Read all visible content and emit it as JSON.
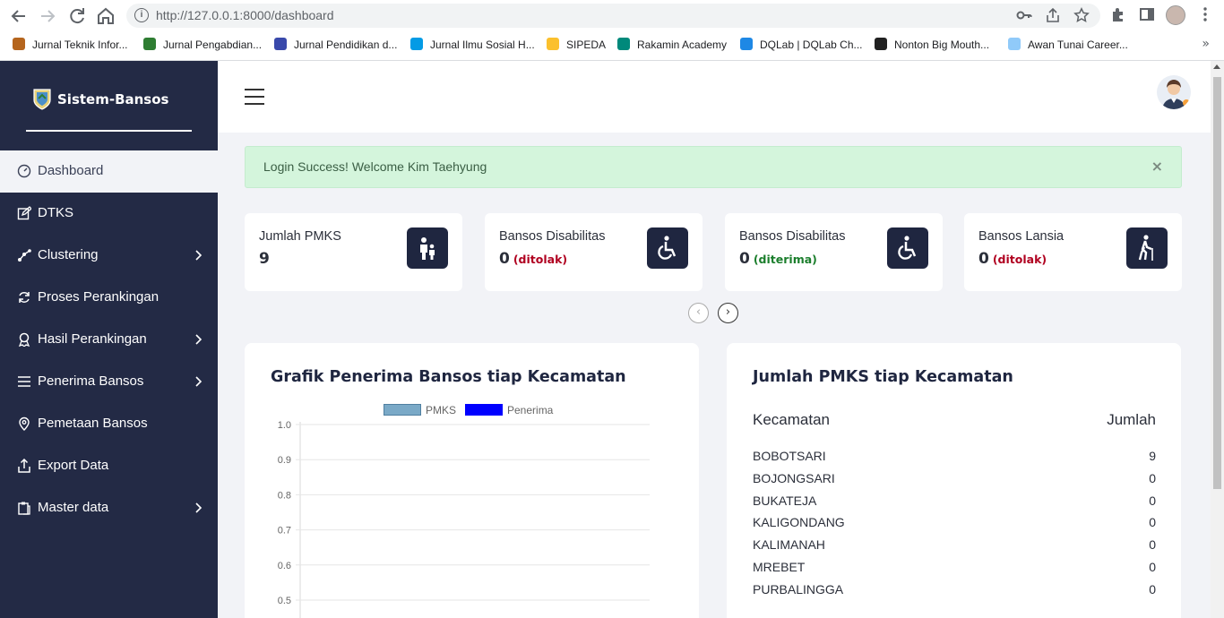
{
  "browser": {
    "url": "http://127.0.0.1:8000/dashboard",
    "bookmarks": [
      {
        "label": "Jurnal Teknik Infor...",
        "color": "#b5651d"
      },
      {
        "label": "Jurnal Pengabdian...",
        "color": "#2e7d32"
      },
      {
        "label": "Jurnal Pendidikan d...",
        "color": "#3949ab"
      },
      {
        "label": "Jurnal Ilmu Sosial H...",
        "color": "#039be5"
      },
      {
        "label": "SIPEDA",
        "color": "#fbc02d"
      },
      {
        "label": "Rakamin Academy",
        "color": "#00897b"
      },
      {
        "label": "DQLab | DQLab Ch...",
        "color": "#1e88e5"
      },
      {
        "label": "Nonton Big Mouth...",
        "color": "#212121"
      },
      {
        "label": "Awan Tunai Career...",
        "color": "#90caf9"
      }
    ],
    "more": "»"
  },
  "sidebar": {
    "brand": "Sistem-Bansos",
    "items": [
      {
        "label": "Dashboard",
        "icon": "dashboard-icon",
        "active": true,
        "has_submenu": false
      },
      {
        "label": "DTKS",
        "icon": "edit-icon",
        "active": false,
        "has_submenu": false
      },
      {
        "label": "Clustering",
        "icon": "nodes-icon",
        "active": false,
        "has_submenu": true
      },
      {
        "label": "Proses Perankingan",
        "icon": "refresh-icon",
        "active": false,
        "has_submenu": false
      },
      {
        "label": "Hasil Perankingan",
        "icon": "award-icon",
        "active": false,
        "has_submenu": true
      },
      {
        "label": "Penerima Bansos",
        "icon": "list-icon",
        "active": false,
        "has_submenu": true
      },
      {
        "label": "Pemetaan Bansos",
        "icon": "map-pin-icon",
        "active": false,
        "has_submenu": false
      },
      {
        "label": "Export Data",
        "icon": "export-icon",
        "active": false,
        "has_submenu": false
      },
      {
        "label": "Master data",
        "icon": "clipboard-icon",
        "active": false,
        "has_submenu": true
      }
    ]
  },
  "alert": {
    "message": "Login Success! Welcome Kim Taehyung",
    "close": "×"
  },
  "cards": [
    {
      "label": "Jumlah PMKS",
      "value": "9",
      "status": "",
      "status_color": "#b00020",
      "icon": "parent-child-icon"
    },
    {
      "label": "Bansos Disabilitas",
      "value": "0",
      "status": "(ditolak)",
      "status_color": "#b00020",
      "icon": "wheelchair-icon"
    },
    {
      "label": "Bansos Disabilitas",
      "value": "0",
      "status": "(diterima)",
      "status_color": "#1b7e2c",
      "icon": "wheelchair-icon"
    },
    {
      "label": "Bansos Lansia",
      "value": "0",
      "status": "(ditolak)",
      "status_color": "#b00020",
      "icon": "elderly-icon"
    }
  ],
  "carousel": {
    "prev": "‹",
    "next": "›"
  },
  "chart_panel": {
    "title": "Grafik Penerima Bansos tiap Kecamatan"
  },
  "chart_data": {
    "type": "bar",
    "title": "Grafik Penerima Bansos tiap Kecamatan",
    "series": [
      {
        "name": "PMKS",
        "color": "#7aa9c7",
        "values": []
      },
      {
        "name": "Penerima",
        "color": "#0000ff",
        "values": []
      }
    ],
    "yticks": [
      "1.0",
      "0.9",
      "0.8",
      "0.7",
      "0.6",
      "0.5"
    ],
    "ylim_visible": [
      0.5,
      1.0
    ],
    "grid": true,
    "legend": "top"
  },
  "table_panel": {
    "title": "Jumlah PMKS tiap Kecamatan",
    "col_kecamatan": "Kecamatan",
    "col_jumlah": "Jumlah",
    "rows": [
      {
        "kecamatan": "BOBOTSARI",
        "jumlah": "9"
      },
      {
        "kecamatan": "BOJONGSARI",
        "jumlah": "0"
      },
      {
        "kecamatan": "BUKATEJA",
        "jumlah": "0"
      },
      {
        "kecamatan": "KALIGONDANG",
        "jumlah": "0"
      },
      {
        "kecamatan": "KALIMANAH",
        "jumlah": "0"
      },
      {
        "kecamatan": "MREBET",
        "jumlah": "0"
      },
      {
        "kecamatan": "PURBALINGGA",
        "jumlah": "0"
      }
    ]
  }
}
